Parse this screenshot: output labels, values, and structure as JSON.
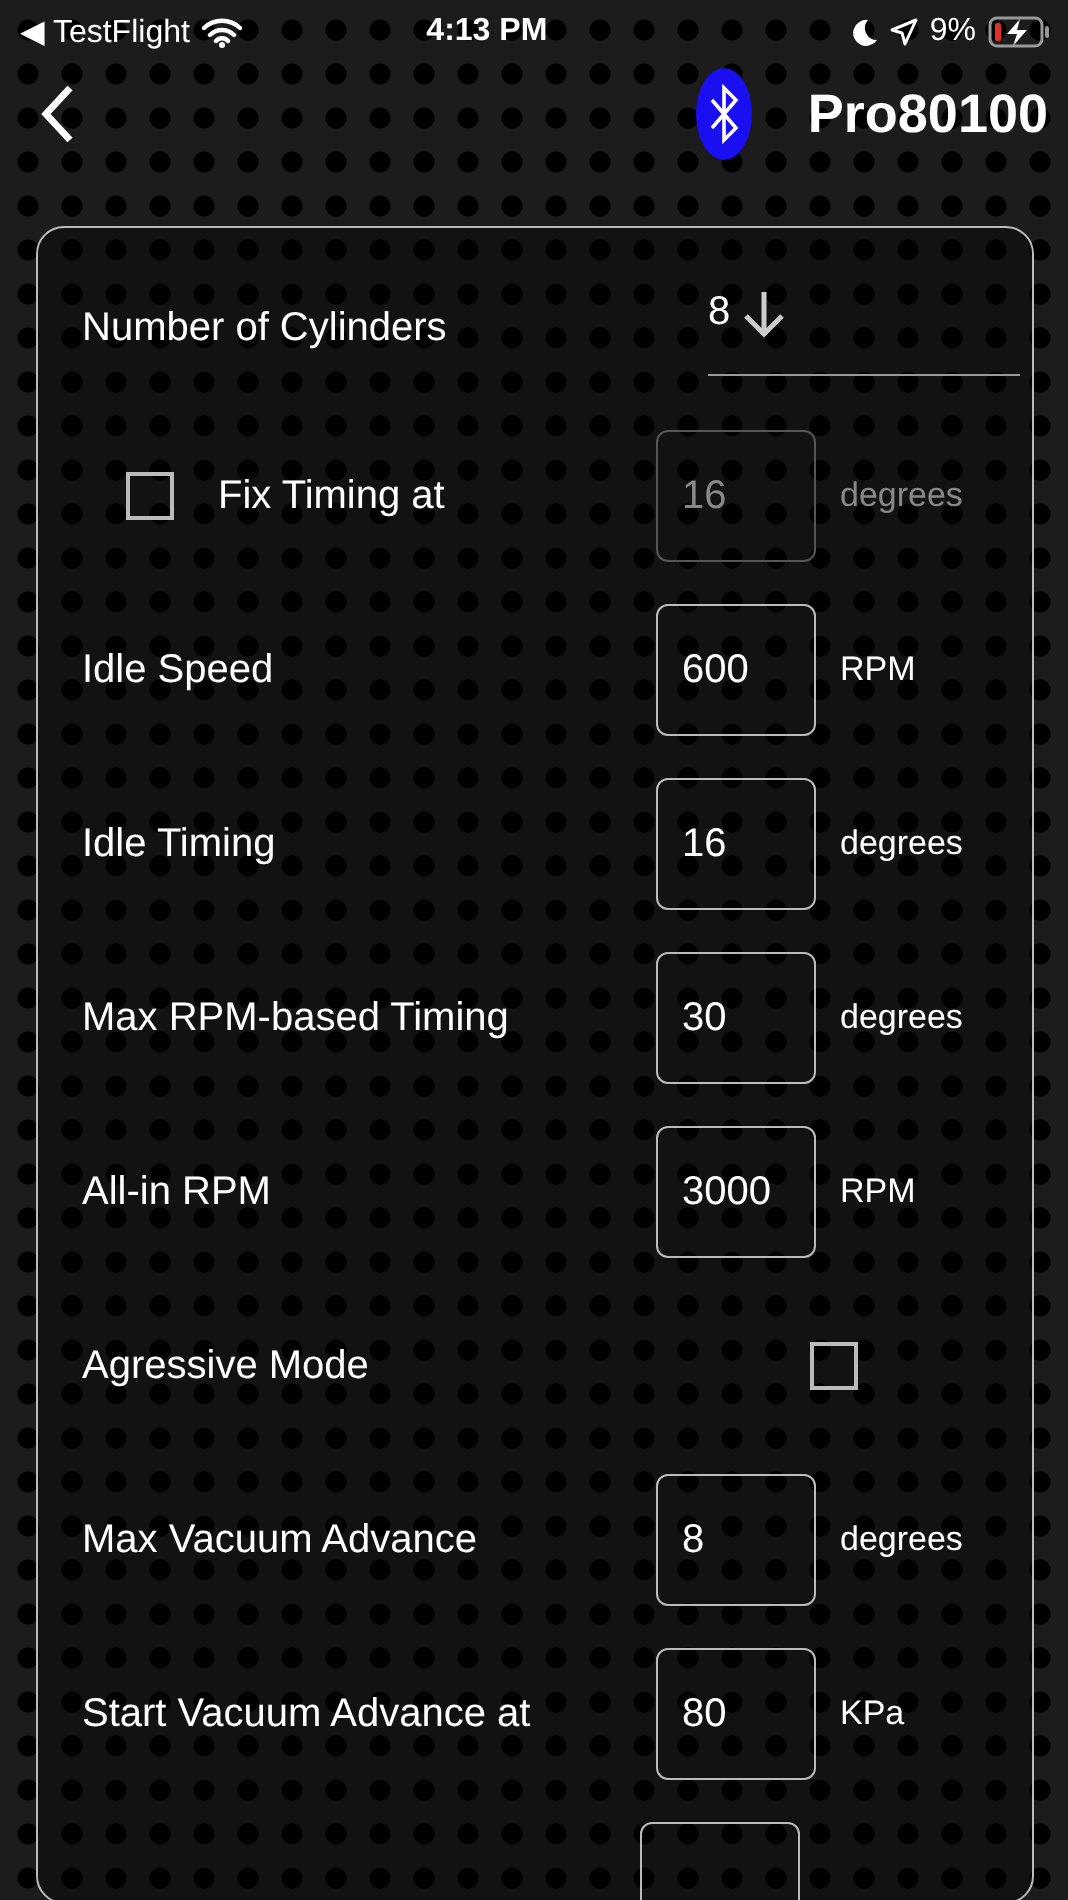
{
  "status_bar": {
    "back_app": "◀ TestFlight",
    "time": "4:13 PM",
    "battery": "9%"
  },
  "header": {
    "title": "Pro80100",
    "bluetooth_connected": true
  },
  "settings": [
    {
      "kind": "dropdown",
      "label": "Number of Cylinders",
      "value": "8"
    },
    {
      "kind": "checkbox_field",
      "label": "Fix Timing at",
      "checked": false,
      "value": "16",
      "unit": "degrees",
      "disabled": true
    },
    {
      "kind": "field",
      "label": "Idle Speed",
      "value": "600",
      "unit": "RPM"
    },
    {
      "kind": "field",
      "label": "Idle Timing",
      "value": "16",
      "unit": "degrees"
    },
    {
      "kind": "field",
      "label": "Max RPM-based Timing",
      "value": "30",
      "unit": "degrees"
    },
    {
      "kind": "field",
      "label": "All-in RPM",
      "value": "3000",
      "unit": "RPM"
    },
    {
      "kind": "checkbox",
      "label": "Agressive Mode",
      "checked": false
    },
    {
      "kind": "field",
      "label": "Max Vacuum Advance",
      "value": "8",
      "unit": "degrees"
    },
    {
      "kind": "field",
      "label": "Start Vacuum Advance at",
      "value": "80",
      "unit": "KPa"
    },
    {
      "kind": "cut_field"
    }
  ]
}
